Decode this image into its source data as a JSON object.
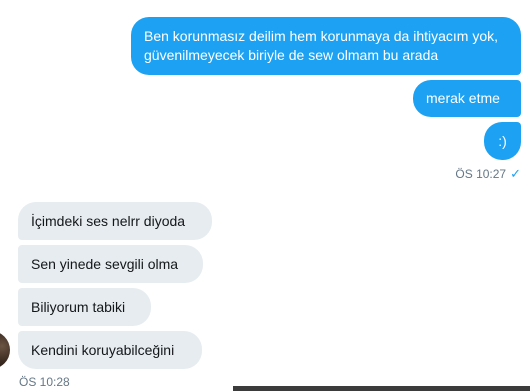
{
  "conversation": {
    "outgoing": [
      {
        "text": "Ben korunmasız deilim hem korunmaya da ihtiyacım yok, güvenilmeyecek biriyle de sew olmam bu arada"
      },
      {
        "text": "merak etme"
      },
      {
        "text": ":)"
      }
    ],
    "outgoing_time": "ÖS 10:27",
    "read_mark": "✓",
    "incoming": [
      {
        "text": "İçimdeki ses nelrr diyoda"
      },
      {
        "text": "Sen yinede sevgili olma"
      },
      {
        "text": "Biliyorum tabiki"
      },
      {
        "text": "Kendini koruyabilceğini"
      }
    ],
    "incoming_time": "ÖS 10:28"
  },
  "colors": {
    "outgoing_bubble": "#1da1f2",
    "incoming_bubble": "#e6ecf0",
    "meta_text": "#657786"
  }
}
